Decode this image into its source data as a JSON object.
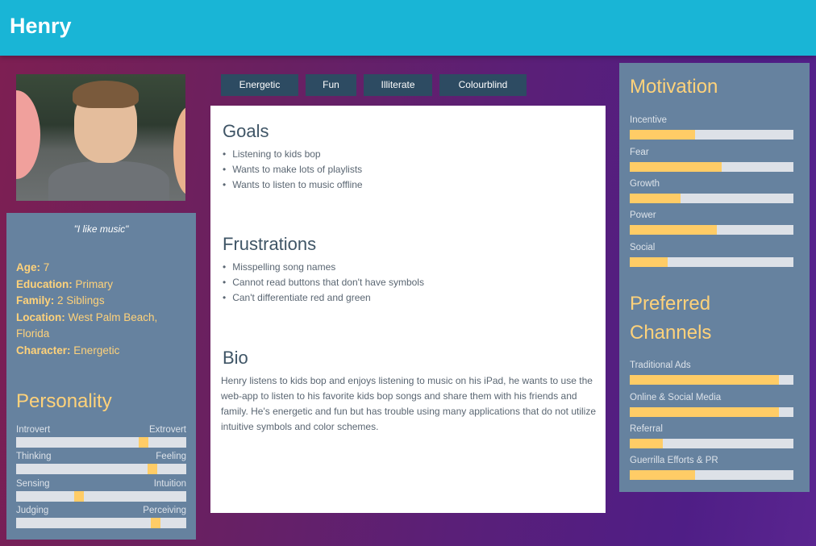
{
  "header": {
    "title": "Henry"
  },
  "profile": {
    "quote": "\"I like music\"",
    "facts": [
      {
        "key": "Age:",
        "value": "7"
      },
      {
        "key": "Education:",
        "value": "Primary"
      },
      {
        "key": "Family:",
        "value": "2 Siblings"
      },
      {
        "key": "Location:",
        "value": "West Palm Beach, Florida"
      },
      {
        "key": "Character:",
        "value": "Energetic"
      }
    ]
  },
  "personality": {
    "title": "Personality",
    "traits": [
      {
        "left": "Introvert",
        "right": "Extrovert",
        "level": 0.75
      },
      {
        "left": "Thinking",
        "right": "Feeling",
        "level": 0.8
      },
      {
        "left": "Sensing",
        "right": "Intuition",
        "level": 0.37
      },
      {
        "left": "Judging",
        "right": "Perceiving",
        "level": 0.82
      }
    ]
  },
  "tags": [
    "Energetic",
    "Fun",
    "Illiterate",
    "Colourblind"
  ],
  "goals": {
    "title": "Goals",
    "items": [
      "Listening to kids bop",
      "Wants to make lots of playlists",
      "Wants to listen to music offline"
    ]
  },
  "frustrations": {
    "title": "Frustrations",
    "items": [
      "Misspelling song names",
      "Cannot read buttons that don't have symbols",
      "Can't differentiate red and green"
    ]
  },
  "bio": {
    "title": "Bio",
    "text": "Henry listens to kids bop and enjoys listening to music on his iPad, he wants to use the web-app to listen to his favorite kids bop songs and share them with his friends and family. He's energetic and fun but has trouble using many applications that do not utilize intuitive symbols and color schemes."
  },
  "motivation": {
    "title": "Motivation",
    "items": [
      {
        "label": "Incentive",
        "level": 0.4
      },
      {
        "label": "Fear",
        "level": 0.56
      },
      {
        "label": "Growth",
        "level": 0.31
      },
      {
        "label": "Power",
        "level": 0.53
      },
      {
        "label": "Social",
        "level": 0.23
      }
    ]
  },
  "channels": {
    "title_line1": "Preferred",
    "title_line2": "Channels",
    "items": [
      {
        "label": "Traditional Ads",
        "level": 0.91
      },
      {
        "label": "Online & Social Media",
        "level": 0.91
      },
      {
        "label": "Referral",
        "level": 0.2
      },
      {
        "label": "Guerrilla Efforts & PR",
        "level": 0.4
      }
    ]
  },
  "colors": {
    "header": "#19b5d6",
    "accent": "#ffd27a",
    "card": "#66829f",
    "tag": "#2d4b62"
  }
}
